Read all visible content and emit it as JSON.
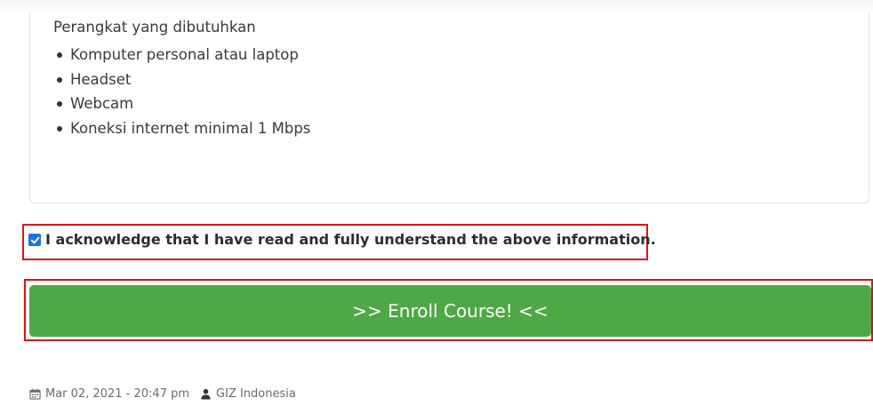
{
  "requirements": {
    "title": "Perangkat yang dibutuhkan",
    "items": [
      "Komputer personal atau laptop",
      "Headset",
      "Webcam",
      "Koneksi internet minimal 1 Mbps"
    ]
  },
  "acknowledge": {
    "checked": true,
    "label": "I acknowledge that I have read and fully understand the above information."
  },
  "enroll": {
    "label": ">> Enroll Course! <<",
    "color": "#4ea845"
  },
  "meta": {
    "date": "Mar 02, 2021 - 20:47 pm",
    "author": "GIZ Indonesia",
    "date_icon": "calendar-icon",
    "author_icon": "user-icon"
  },
  "colors": {
    "highlight": "#e0101a",
    "checkbox": "#1a73e8"
  }
}
